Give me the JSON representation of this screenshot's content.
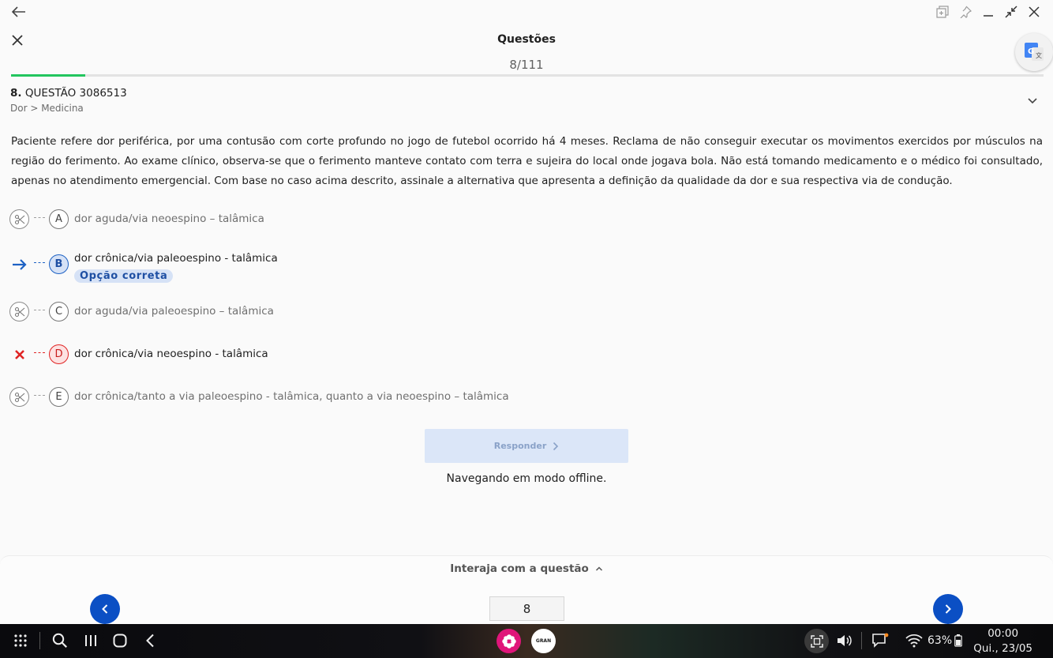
{
  "window": {
    "back_icon": "arrow-left-icon",
    "controls": [
      "add-window-icon",
      "pin-icon",
      "minimize-icon",
      "shrink-icon",
      "close-icon"
    ]
  },
  "header": {
    "title": "Questões",
    "counter": "8/111",
    "progress_fraction": 0.072,
    "close_icon": "close-icon",
    "translate_icon": "google-translate-icon"
  },
  "question": {
    "number": "8.",
    "code": "QUESTÃO 3086513",
    "breadcrumb": "Dor > Medicina",
    "statement": "Paciente refere dor periférica, por uma contusão com corte profundo no jogo de futebol ocorrido há 4 meses. Reclama de não conseguir executar os movimentos exercidos por músculos na região do ferimento. Ao exame clínico, observa-se que o ferimento manteve contato com terra e sujeira do local onde jogava bola. Não está tomando medicamento e o médico foi consultado, apenas no atendimento emergencial. Com base no caso acima descrito, assinale a alternativa que apresenta a definição da qualidade da dor e sua respectiva via de condução."
  },
  "options": [
    {
      "letter": "A",
      "text": "dor aguda/via neoespino – talâmica",
      "state": "eliminated"
    },
    {
      "letter": "B",
      "text": "dor crônica/via paleoespino - talâmica",
      "state": "correct",
      "badge": "Opção correta"
    },
    {
      "letter": "C",
      "text": "dor aguda/via paleoespino – talâmica",
      "state": "eliminated"
    },
    {
      "letter": "D",
      "text": "dor crônica/via neoespino - talâmica",
      "state": "wrong"
    },
    {
      "letter": "E",
      "text": "dor crônica/tanto a via paleoespino - talâmica, quanto a via neoespino – talâmica",
      "state": "eliminated"
    }
  ],
  "colors": {
    "accent_blue": "#0b4fc4",
    "correct_blue": "#1e62c4",
    "wrong_red": "#e02424",
    "progress_green": "#22c55e"
  },
  "actions": {
    "respond_label": "Responder",
    "offline_message": "Navegando em modo offline."
  },
  "bottom": {
    "interact_label": "Interaja com a questão",
    "page_value": "8"
  },
  "taskbar": {
    "app1": "flower-app-icon",
    "app2_label": "GRAN",
    "battery": "63%",
    "time": "00:00",
    "date": "Qui., 23/05"
  }
}
